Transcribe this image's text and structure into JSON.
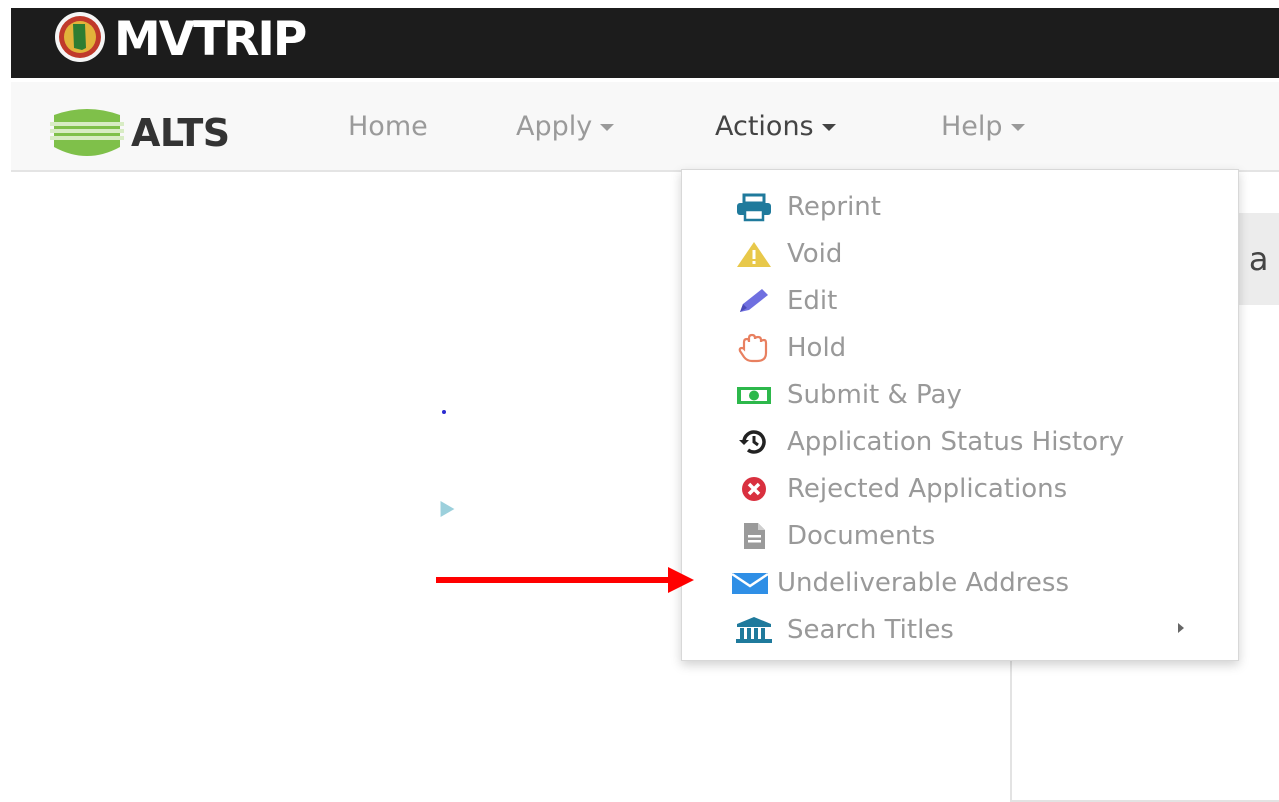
{
  "header": {
    "title": "MVTRIP",
    "logo_icon": "alabama-seal-icon"
  },
  "navbar": {
    "brand": "ALTS",
    "brand_icon": "alts-shield-icon",
    "items": [
      {
        "label": "Home",
        "has_caret": false
      },
      {
        "label": "Apply",
        "has_caret": true
      },
      {
        "label": "Actions",
        "has_caret": true,
        "active": true
      },
      {
        "label": "Help",
        "has_caret": true
      }
    ]
  },
  "actions_menu": {
    "items": [
      {
        "label": "Reprint",
        "icon": "print-icon",
        "color": "#1f7a9c"
      },
      {
        "label": "Void",
        "icon": "warning-icon",
        "color": "#e8c84a"
      },
      {
        "label": "Edit",
        "icon": "pencil-icon",
        "color": "#6f6fe0"
      },
      {
        "label": "Hold",
        "icon": "hand-icon",
        "color": "#e88060"
      },
      {
        "label": "Submit & Pay",
        "icon": "money-icon",
        "color": "#2db84b"
      },
      {
        "label": "Application Status History",
        "icon": "history-icon",
        "color": "#222222"
      },
      {
        "label": "Rejected Applications",
        "icon": "times-circle-icon",
        "color": "#d9303f"
      },
      {
        "label": "Documents",
        "icon": "file-icon",
        "color": "#9a9a9a"
      },
      {
        "label": "Undeliverable Address",
        "icon": "envelope-icon",
        "color": "#2f8fe6"
      },
      {
        "label": "Search Titles",
        "icon": "bank-icon",
        "color": "#1f7a9c",
        "has_submenu": true
      }
    ]
  },
  "background": {
    "partial_text": "s a"
  },
  "annotation": {
    "arrow_color": "#ff0000"
  }
}
